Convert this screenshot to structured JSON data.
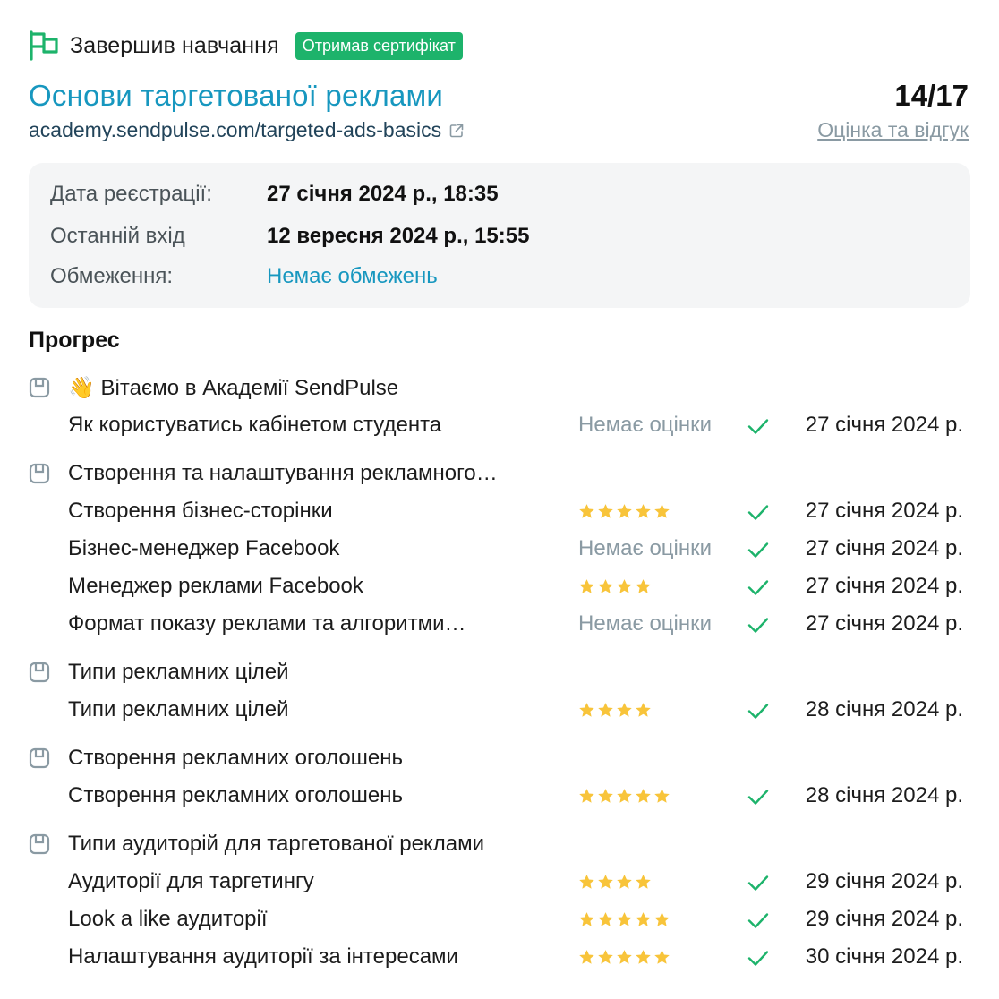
{
  "header": {
    "status": "Завершив навчання",
    "badge": "Отримав сертифікат",
    "colors": {
      "badge": "#1db36b",
      "accent": "#1797bf",
      "flag": "#1db36b"
    }
  },
  "course": {
    "title": "Основи таргетованої реклами",
    "url": "academy.sendpulse.com/targeted-ads-basics",
    "score": "14/17",
    "review_link": "Оцінка та відгук"
  },
  "info": {
    "registration_label": "Дата реєстрації:",
    "registration_value": "27 січня 2024 р., 18:35",
    "last_login_label": "Останній вхід",
    "last_login_value": "12 вересня 2024 р., 15:55",
    "restrictions_label": "Обмеження:",
    "restrictions_value": "Немає обмежень"
  },
  "progress": {
    "title": "Прогрес",
    "no_rating_text": "Немає оцінки",
    "sections": [
      {
        "title": "👋 Вітаємо в Академії SendPulse",
        "lessons": [
          {
            "name": "Як користуватись кабінетом студента",
            "rating": 0,
            "date": "27 січня 2024 р."
          }
        ]
      },
      {
        "title": "Створення та налаштування рекламного…",
        "lessons": [
          {
            "name": "Створення бізнес-сторінки",
            "rating": 5,
            "date": "27 січня 2024 р."
          },
          {
            "name": "Бізнес-менеджер Facebook",
            "rating": 0,
            "date": "27 січня 2024 р."
          },
          {
            "name": "Менеджер реклами Facebook",
            "rating": 4,
            "date": "27 січня 2024 р."
          },
          {
            "name": "Формат показу реклами та алгоритми…",
            "rating": 0,
            "date": "27 січня 2024 р."
          }
        ]
      },
      {
        "title": "Типи рекламних цілей",
        "lessons": [
          {
            "name": "Типи рекламних цілей",
            "rating": 4,
            "date": "28 січня 2024 р."
          }
        ]
      },
      {
        "title": "Створення рекламних оголошень",
        "lessons": [
          {
            "name": "Створення рекламних оголошень",
            "rating": 5,
            "date": "28 січня 2024 р."
          }
        ]
      },
      {
        "title": "Типи аудиторій для таргетованої реклами",
        "lessons": [
          {
            "name": "Аудиторії для таргетингу",
            "rating": 4,
            "date": "29 січня 2024 р."
          },
          {
            "name": "Look a like аудиторії",
            "rating": 5,
            "date": "29 січня 2024 р."
          },
          {
            "name": "Налаштування аудиторії за інтересами",
            "rating": 5,
            "date": "30 січня 2024 р."
          }
        ]
      }
    ],
    "icons": {
      "module": "module-box-icon",
      "check": "check-icon",
      "star": "star-icon"
    },
    "colors": {
      "star": "#f8c43a",
      "check": "#1db36b",
      "module_icon": "#8a9aa3"
    }
  }
}
